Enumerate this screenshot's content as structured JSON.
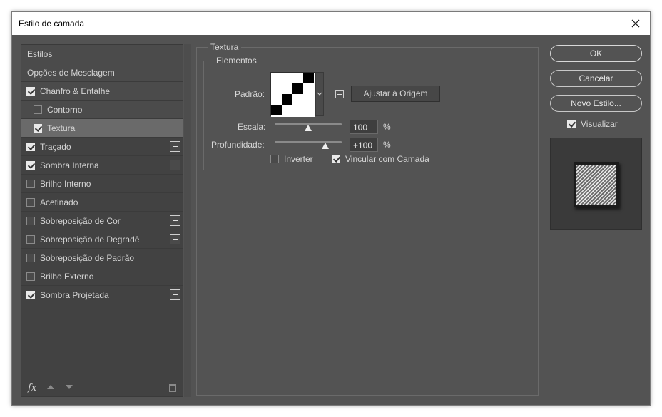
{
  "window": {
    "title": "Estilo de camada"
  },
  "sidebar": {
    "items": [
      {
        "label": "Estilos",
        "checkbox": null,
        "plus": false,
        "indent": false
      },
      {
        "label": "Opções de Mesclagem",
        "checkbox": null,
        "plus": false,
        "indent": false
      },
      {
        "label": "Chanfro & Entalhe",
        "checkbox": true,
        "plus": false,
        "indent": false
      },
      {
        "label": "Contorno",
        "checkbox": false,
        "plus": false,
        "indent": true
      },
      {
        "label": "Textura",
        "checkbox": true,
        "plus": false,
        "indent": true,
        "selected": true
      },
      {
        "label": "Traçado",
        "checkbox": true,
        "plus": true,
        "indent": false
      },
      {
        "label": "Sombra Interna",
        "checkbox": true,
        "plus": true,
        "indent": false
      },
      {
        "label": "Brilho Interno",
        "checkbox": false,
        "plus": false,
        "indent": false
      },
      {
        "label": "Acetinado",
        "checkbox": false,
        "plus": false,
        "indent": false
      },
      {
        "label": "Sobreposição de Cor",
        "checkbox": false,
        "plus": true,
        "indent": false
      },
      {
        "label": "Sobreposição de Degradê",
        "checkbox": false,
        "plus": true,
        "indent": false
      },
      {
        "label": "Sobreposição de Padrão",
        "checkbox": false,
        "plus": false,
        "indent": false
      },
      {
        "label": "Brilho Externo",
        "checkbox": false,
        "plus": false,
        "indent": false
      },
      {
        "label": "Sombra Projetada",
        "checkbox": true,
        "plus": true,
        "indent": false
      }
    ],
    "fx_label": "fx"
  },
  "texture": {
    "section_title": "Textura",
    "group_title": "Elementos",
    "pattern_label": "Padrão:",
    "snap_button": "Ajustar à Origem",
    "scale_label": "Escala:",
    "scale_value": "100",
    "scale_unit": "%",
    "scale_level": 0.5,
    "depth_label": "Profundidade:",
    "depth_value": "+100",
    "depth_unit": "%",
    "depth_level": 0.75,
    "invert_label": "Inverter",
    "invert_checked": false,
    "link_label": "Vincular com Camada",
    "link_checked": true
  },
  "actions": {
    "ok": "OK",
    "cancel": "Cancelar",
    "new_style": "Novo Estilo...",
    "preview_label": "Visualizar",
    "preview_checked": true
  },
  "colors": {
    "dialog_bg": "#535353",
    "list_bg": "#424242",
    "selected_row": "#6a6a6a"
  }
}
